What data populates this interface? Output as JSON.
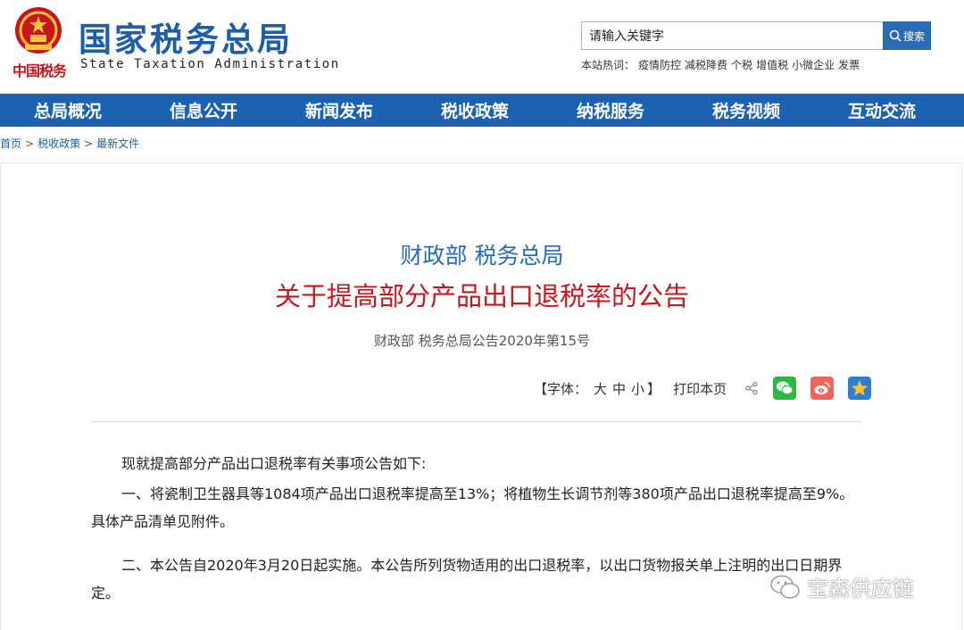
{
  "header": {
    "site_title": "国家税务总局",
    "site_subtitle": "State Taxation Administration",
    "emblem_script": "中国税务",
    "search": {
      "value": "请输入关键字",
      "button_label": "搜索"
    },
    "hot_label": "本站热词：",
    "hot_words": [
      "疫情防控",
      "减税降费",
      "个税",
      "增值税",
      "小微企业",
      "发票"
    ]
  },
  "nav": {
    "items": [
      "总局概况",
      "信息公开",
      "新闻发布",
      "税收政策",
      "纳税服务",
      "税务视频",
      "互动交流"
    ]
  },
  "breadcrumb": {
    "items": [
      "首页",
      "税收政策",
      "最新文件"
    ],
    "separator": ">"
  },
  "article": {
    "department": "财政部 税务总局",
    "title": "关于提高部分产品出口退税率的公告",
    "doc_number": "财政部 税务总局公告2020年第15号",
    "tools": {
      "font_label_open": "【字体：",
      "font_large": "大",
      "font_medium": "中",
      "font_small": "小",
      "font_label_close": "】",
      "print_label": "打印本页"
    },
    "paragraphs": [
      "现就提高部分产品出口退税率有关事项公告如下:",
      "一、将瓷制卫生器具等1084项产品出口退税率提高至13%；将植物生长调节剂等380项产品出口退税率提高至9%。具体产品清单见附件。",
      "二、本公告自2020年3月20日起实施。本公告所列货物适用的出口退税率，以出口货物报关单上注明的出口日期界定。"
    ]
  },
  "watermark": {
    "text": "宝森供应链"
  },
  "colors": {
    "brand_blue": "#1d62b0",
    "title_red": "#c8161d",
    "link_blue": "#1d5ea8"
  }
}
